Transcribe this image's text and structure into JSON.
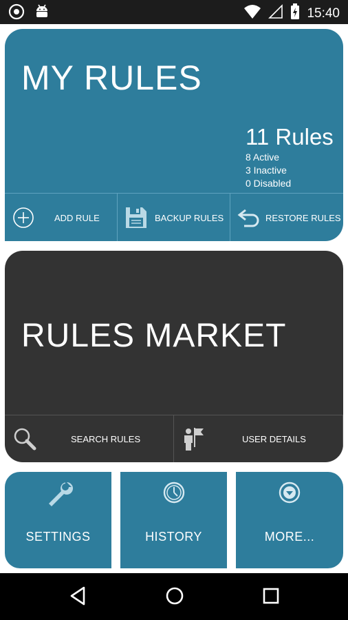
{
  "status_bar": {
    "time": "15:40",
    "icons": [
      "target-icon",
      "android-icon",
      "wifi-icon",
      "signal-icon",
      "battery-icon"
    ]
  },
  "my_rules": {
    "title": "MY RULES",
    "count": "11 Rules",
    "active": "8 Active",
    "inactive": "3 Inactive",
    "disabled": "0 Disabled",
    "actions": {
      "add": "ADD RULE",
      "backup": "BACKUP RULES",
      "restore": "RESTORE RULES"
    }
  },
  "market": {
    "title": "RULES MARKET",
    "actions": {
      "search": "SEARCH RULES",
      "user": "USER DETAILS"
    }
  },
  "tiles": {
    "settings": "SETTINGS",
    "history": "HISTORY",
    "more": "MORE..."
  },
  "colors": {
    "accent": "#2e7d9c",
    "market": "#333333",
    "status_bar": "#1c1c1c",
    "nav_bar": "#000000"
  },
  "nav": [
    "back-icon",
    "home-icon",
    "recents-icon"
  ]
}
